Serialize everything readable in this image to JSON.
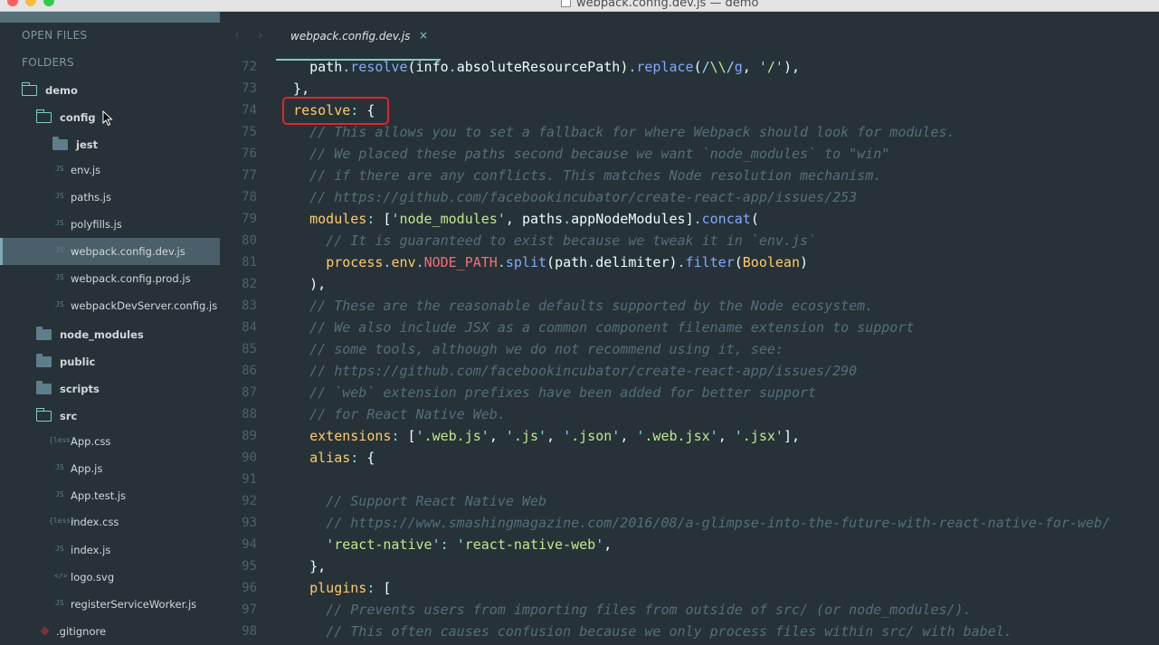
{
  "window": {
    "title": "webpack.config.dev.js — demo"
  },
  "sidebar": {
    "open_files_label": "OPEN FILES",
    "folders_label": "FOLDERS",
    "tree": [
      {
        "label": "demo",
        "kind": "folder-open"
      },
      {
        "label": "config",
        "kind": "folder-open"
      },
      {
        "label": "jest",
        "kind": "folder"
      },
      {
        "label": "env.js",
        "kind": "file",
        "icon": "JS"
      },
      {
        "label": "paths.js",
        "kind": "file",
        "icon": "JS"
      },
      {
        "label": "polyfills.js",
        "kind": "file",
        "icon": "JS"
      },
      {
        "label": "webpack.config.dev.js",
        "kind": "file",
        "icon": "JS",
        "selected": true
      },
      {
        "label": "webpack.config.prod.js",
        "kind": "file",
        "icon": "JS"
      },
      {
        "label": "webpackDevServer.config.js",
        "kind": "file",
        "icon": "JS"
      },
      {
        "label": "node_modules",
        "kind": "folder"
      },
      {
        "label": "public",
        "kind": "folder"
      },
      {
        "label": "scripts",
        "kind": "folder"
      },
      {
        "label": "src",
        "kind": "folder-open"
      },
      {
        "label": "App.css",
        "kind": "file",
        "icon": "{less}"
      },
      {
        "label": "App.js",
        "kind": "file",
        "icon": "JS"
      },
      {
        "label": "App.test.js",
        "kind": "file",
        "icon": "JS"
      },
      {
        "label": "index.css",
        "kind": "file",
        "icon": "{less}"
      },
      {
        "label": "index.js",
        "kind": "file",
        "icon": "JS"
      },
      {
        "label": "logo.svg",
        "kind": "file",
        "icon": "</>"
      },
      {
        "label": "registerServiceWorker.js",
        "kind": "file",
        "icon": "JS"
      },
      {
        "label": ".gitignore",
        "kind": "git"
      }
    ]
  },
  "editor": {
    "tab": {
      "label": "webpack.config.dev.js",
      "close": "×"
    },
    "nav": {
      "back": "‹",
      "forward": "›"
    },
    "lines": [
      {
        "n": "72",
        "t": "    path.resolve(info.absoluteResourcePath).replace(/\\\\/g, '/'),"
      },
      {
        "n": "73",
        "t": "  },"
      },
      {
        "n": "74",
        "t": "  resolve: {"
      },
      {
        "n": "75",
        "t": "    // This allows you to set a fallback for where Webpack should look for modules."
      },
      {
        "n": "76",
        "t": "    // We placed these paths second because we want `node_modules` to \"win\""
      },
      {
        "n": "77",
        "t": "    // if there are any conflicts. This matches Node resolution mechanism."
      },
      {
        "n": "78",
        "t": "    // https://github.com/facebookincubator/create-react-app/issues/253"
      },
      {
        "n": "79",
        "t": "    modules: ['node_modules', paths.appNodeModules].concat("
      },
      {
        "n": "80",
        "t": "      // It is guaranteed to exist because we tweak it in `env.js`"
      },
      {
        "n": "81",
        "t": "      process.env.NODE_PATH.split(path.delimiter).filter(Boolean)"
      },
      {
        "n": "82",
        "t": "    ),"
      },
      {
        "n": "83",
        "t": "    // These are the reasonable defaults supported by the Node ecosystem."
      },
      {
        "n": "84",
        "t": "    // We also include JSX as a common component filename extension to support"
      },
      {
        "n": "85",
        "t": "    // some tools, although we do not recommend using it, see:"
      },
      {
        "n": "86",
        "t": "    // https://github.com/facebookincubator/create-react-app/issues/290"
      },
      {
        "n": "87",
        "t": "    // `web` extension prefixes have been added for better support"
      },
      {
        "n": "88",
        "t": "    // for React Native Web."
      },
      {
        "n": "89",
        "t": "    extensions: ['.web.js', '.js', '.json', '.web.jsx', '.jsx'],"
      },
      {
        "n": "90",
        "t": "    alias: {"
      },
      {
        "n": "91",
        "t": ""
      },
      {
        "n": "92",
        "t": "      // Support React Native Web"
      },
      {
        "n": "93",
        "t": "      // https://www.smashingmagazine.com/2016/08/a-glimpse-into-the-future-with-react-native-for-web/"
      },
      {
        "n": "94",
        "t": "      'react-native': 'react-native-web',"
      },
      {
        "n": "95",
        "t": "    },"
      },
      {
        "n": "96",
        "t": "    plugins: ["
      },
      {
        "n": "97",
        "t": "      // Prevents users from importing files from outside of src/ (or node_modules/)."
      },
      {
        "n": "98",
        "t": "      // This often causes confusion because we only process files within src/ with babel."
      }
    ]
  }
}
